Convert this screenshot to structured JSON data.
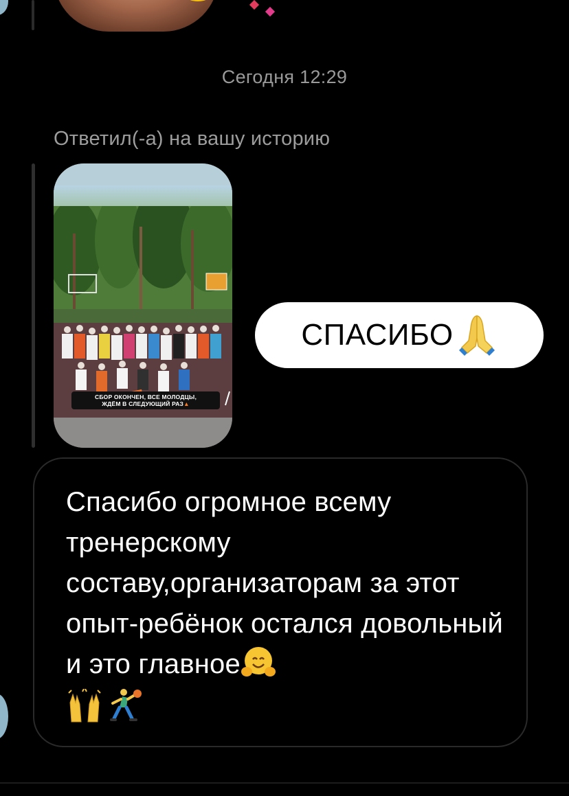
{
  "thread": {
    "timestamp": "Сегодня 12:29",
    "reply_label": "Ответил(-а) на вашу историю"
  },
  "story": {
    "caption_line1": "СБОР ОКОНЧЕН, ВСЕ МОЛОДЦЫ,",
    "caption_line2": "ЖДЁМ В СЛЕДУЮЩИЙ РАЗ"
  },
  "sent_message": {
    "text": "СПАСИБО",
    "emoji": "folded-hands-icon"
  },
  "received_message": {
    "text": "Спасибо огромное всему тренерскому составу,организаторам за этот опыт-ребёнок остался довольный и это главное",
    "emojis": [
      "hugging-face-icon",
      "raising-hands-icon",
      "basketball-player-icon"
    ]
  },
  "colors": {
    "background": "#000000",
    "sent_bubble": "#ffffff",
    "received_border": "#2a2a2a",
    "meta_text": "#9a9a9a"
  }
}
